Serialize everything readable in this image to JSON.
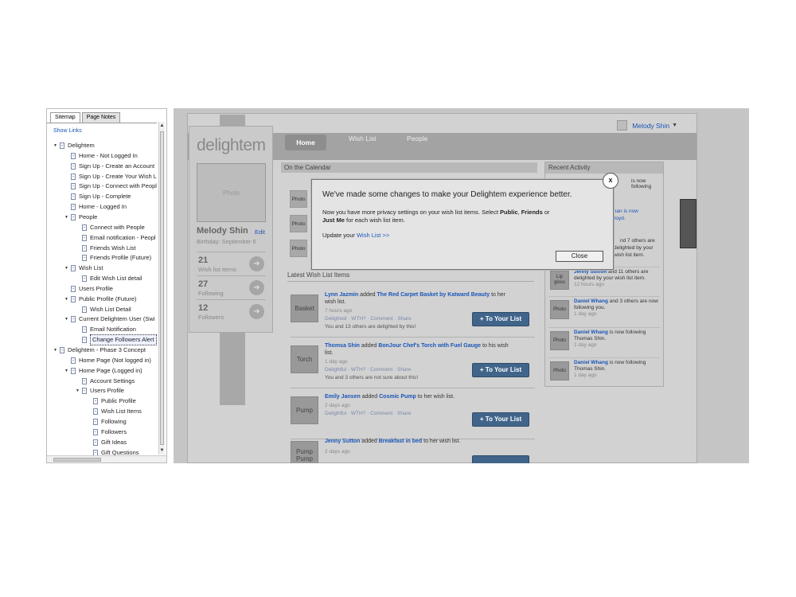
{
  "sitemap": {
    "tabs": [
      "Sitemap",
      "Page Notes"
    ],
    "show_links": "Show Links",
    "nodes": [
      {
        "label": "Delightem",
        "depth": 0,
        "expanded": true
      },
      {
        "label": "Home - Not Logged In",
        "depth": 1
      },
      {
        "label": "Sign Up - Create an Account",
        "depth": 1
      },
      {
        "label": "Sign Up - Create Your Wish L",
        "depth": 1
      },
      {
        "label": "Sign Up - Connect with Peopl",
        "depth": 1
      },
      {
        "label": "Sign Up - Complete",
        "depth": 1
      },
      {
        "label": "Home - Logged In",
        "depth": 1
      },
      {
        "label": "People",
        "depth": 1,
        "expanded": true
      },
      {
        "label": "Connect with People",
        "depth": 2
      },
      {
        "label": "Email notification - Peopl",
        "depth": 2
      },
      {
        "label": "Friends Wish List",
        "depth": 2
      },
      {
        "label": "Friends Profile (Future)",
        "depth": 2
      },
      {
        "label": "Wish List",
        "depth": 1,
        "expanded": true
      },
      {
        "label": "Edit Wish List detail",
        "depth": 2
      },
      {
        "label": "Users Profile",
        "depth": 1
      },
      {
        "label": "Public Profile (Future)",
        "depth": 1,
        "expanded": true
      },
      {
        "label": "Wish List Detail",
        "depth": 2
      },
      {
        "label": "Current Delightem User (Swi",
        "depth": 1,
        "expanded": true
      },
      {
        "label": "Email Notification",
        "depth": 2
      },
      {
        "label": "Change Followers Alert",
        "depth": 2,
        "selected": true
      },
      {
        "label": "Delightem - Phase 3 Concept",
        "depth": 0,
        "expanded": true
      },
      {
        "label": "Home Page (Not logged in)",
        "depth": 1
      },
      {
        "label": "Home Page (Logged in)",
        "depth": 1,
        "expanded": true
      },
      {
        "label": "Account Settings",
        "depth": 2
      },
      {
        "label": "Users Profile",
        "depth": 2,
        "expanded": true
      },
      {
        "label": "Public Profile",
        "depth": 3
      },
      {
        "label": "Wish List Items",
        "depth": 3
      },
      {
        "label": "Following",
        "depth": 3
      },
      {
        "label": "Followers",
        "depth": 3
      },
      {
        "label": "Gift Ideas",
        "depth": 3
      },
      {
        "label": "Gift Questions",
        "depth": 3
      }
    ]
  },
  "app": {
    "logo": "delightem",
    "user": "Melody Shin",
    "nav": {
      "home": "Home",
      "wishlist": "Wish List",
      "people": "People"
    },
    "profile": {
      "photo": "Photo",
      "name": "Melody Shin",
      "edit": "Edit",
      "birthday": "Birthday: September 6",
      "stats": [
        {
          "num": "21",
          "label": "Wish list items"
        },
        {
          "num": "27",
          "label": "Following"
        },
        {
          "num": "12",
          "label": "Followers"
        }
      ]
    },
    "calendar": {
      "title": "On the Calendar",
      "photos": [
        "Photo",
        "Photo",
        "Photo"
      ]
    },
    "feed": {
      "title": "Latest Wish List Items",
      "items": [
        {
          "thumb": "Basket",
          "user": "Lynn Jazmin",
          "verb": "added",
          "item": "The Red Carpet Basket by Katward Beauty",
          "rest": "to her wish list.",
          "time": "7 hours ago",
          "actions": "Delighted · WTH? · Comment · Share",
          "summary": "You and 13 others are delighted by this!",
          "button": "+ To Your List"
        },
        {
          "thumb": "Torch",
          "user": "Thomsa Shin",
          "verb": "added",
          "item": "BonJour Chef's Torch with Fuel Gauge",
          "rest": "to his wish list.",
          "time": "1 day ago",
          "actions": "Delightful · WTH? · Comment · Share",
          "summary": "You and 3 others are not sure about this!",
          "button": "+ To Your List"
        },
        {
          "thumb": "Pump",
          "user": "Emily Jansen",
          "verb": "added",
          "item": "Cosmic Pump",
          "rest": "to her wish list.",
          "time": "2 days ago",
          "actions": "Delightful · WTH? · Comment · Share",
          "summary": "",
          "button": "+ To Your List"
        },
        {
          "thumb": "Pump Pump",
          "user": "Jenny Sutton",
          "verb": "added",
          "item": "Breakfast in bed",
          "rest": "to her wish list.",
          "time": "2 days ago",
          "actions": "",
          "summary": "",
          "button": ""
        }
      ]
    },
    "activity": {
      "title": "Recent Activity",
      "partials": [
        "is now following",
        "man is now",
        "Boyd.",
        "nd 7 others are",
        "delighted by your",
        "wish list item."
      ],
      "items": [
        {
          "photo": "Lip gloss",
          "name": "Jenny Sutton",
          "text": "and 11 others are delighted by your wish list item.",
          "time": "12 hours ago"
        },
        {
          "photo": "Photo",
          "name": "Daniel Whang",
          "text": "and 3 others are now following you.",
          "time": "1 day ago"
        },
        {
          "photo": "Photo",
          "name": "Daniel Whang",
          "text": "is now following Thomas Shin.",
          "time": "1 day ago"
        },
        {
          "photo": "Photo",
          "name": "Daniel Whang",
          "text": "is now following Thomas Shin.",
          "time": "1 day ago"
        }
      ]
    }
  },
  "modal": {
    "title": "We've made some changes to make your Delightem experience better.",
    "body_pre": "Now you have more privacy settings on your wish list items.  Select ",
    "opt1": "Public",
    "sep1": ", ",
    "opt2": "Friends",
    "sep2": " or",
    "opt3": "Just Me",
    "body_post": " for each wish list item.",
    "update_pre": "Update your ",
    "update_link": "Wish List >>",
    "close": "Close",
    "x": "x"
  }
}
